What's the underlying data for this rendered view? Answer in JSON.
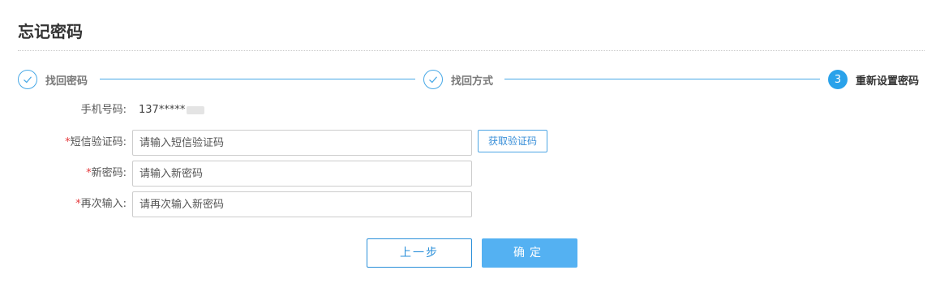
{
  "page": {
    "title": "忘记密码"
  },
  "steps": [
    {
      "label": "找回密码",
      "state": "done",
      "icon": "check-icon"
    },
    {
      "label": "找回方式",
      "state": "done",
      "icon": "check-icon"
    },
    {
      "label": "重新设置密码",
      "state": "active",
      "number": "3"
    }
  ],
  "form": {
    "phone": {
      "label": "手机号码:",
      "value": "137*****"
    },
    "sms_code": {
      "required_mark": "*",
      "label": "短信验证码:",
      "placeholder": "请输入短信验证码",
      "value": "",
      "button_label": "获取验证码"
    },
    "new_password": {
      "required_mark": "*",
      "label": "新密码:",
      "placeholder": "请输入新密码",
      "value": ""
    },
    "confirm_password": {
      "required_mark": "*",
      "label": "再次输入:",
      "placeholder": "请再次输入新密码",
      "value": ""
    }
  },
  "actions": {
    "prev_label": "上一步",
    "confirm_label": "确定"
  },
  "colors": {
    "accent": "#2aa2ea",
    "line": "#47a8e6",
    "confirm_bg": "#54b1f2",
    "required": "#e4393c"
  }
}
